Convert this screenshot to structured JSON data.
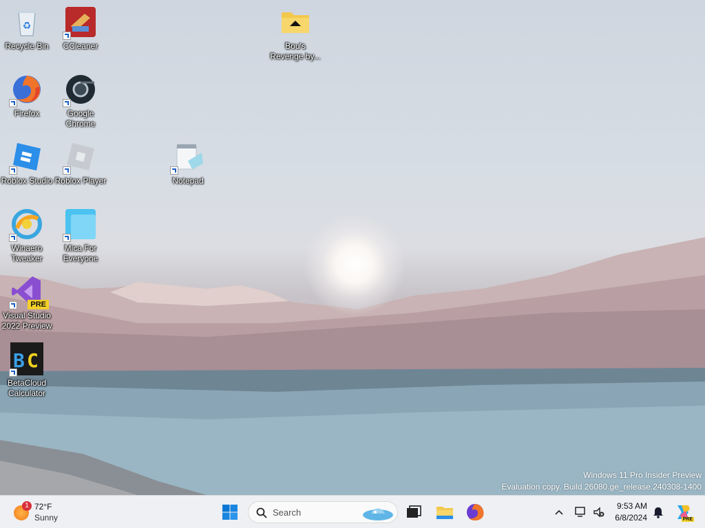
{
  "desktop": {
    "icons": [
      {
        "label": "Recycle Bin"
      },
      {
        "label": "CCleaner"
      },
      {
        "label": "Bou's Revenge by..."
      },
      {
        "label": "Firefox"
      },
      {
        "label": "Google Chrome"
      },
      {
        "label": "Roblox Studio"
      },
      {
        "label": "Roblox Player"
      },
      {
        "label": "Notepad"
      },
      {
        "label": "Winaero Tweaker"
      },
      {
        "label": "Mica For Everyone"
      },
      {
        "label": "Visual Studio 2022 Preview"
      },
      {
        "label": "BetaCloud Calculator"
      }
    ],
    "watermark": {
      "line1": "Windows 11 Pro Insider Preview",
      "line2": "Evaluation copy. Build 26080.ge_release.240308-1400"
    }
  },
  "taskbar": {
    "weather": {
      "badge": "1",
      "temp": "72°F",
      "condition": "Sunny"
    },
    "search": {
      "placeholder": "Search"
    },
    "pinned": [
      "start-icon",
      "task-view-icon",
      "file-explorer-icon",
      "firefox-icon"
    ],
    "clock": {
      "time": "9:53 AM",
      "date": "6/8/2024"
    },
    "copilot_badge": "PRE",
    "vs_badge": "PRE"
  }
}
